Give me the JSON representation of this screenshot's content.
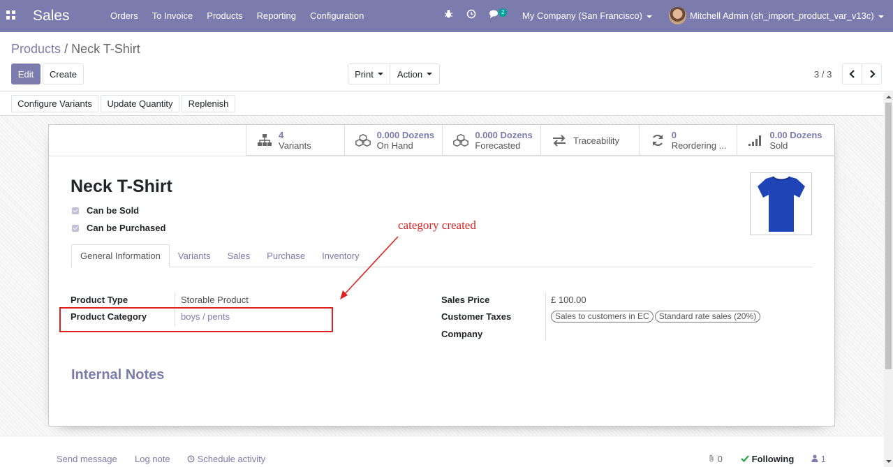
{
  "navbar": {
    "app_name": "Sales",
    "menu": [
      "Orders",
      "To Invoice",
      "Products",
      "Reporting",
      "Configuration"
    ],
    "chat_badge": "2",
    "company": "My Company (San Francisco)",
    "user": "Mitchell Admin (sh_import_product_var_v13c)"
  },
  "breadcrumb": {
    "parent": "Products",
    "separator": "/",
    "current": "Neck T-Shirt"
  },
  "toolbar": {
    "edit_label": "Edit",
    "create_label": "Create",
    "print_label": "Print",
    "action_label": "Action",
    "pager": "3 / 3"
  },
  "statusbar": {
    "configure_variants": "Configure Variants",
    "update_quantity": "Update Quantity",
    "replenish": "Replenish"
  },
  "stats": [
    {
      "value": "4",
      "label": "Variants",
      "icon": "sitemap-icon"
    },
    {
      "value": "0.000 Dozens",
      "label": "On Hand",
      "icon": "cubes-icon"
    },
    {
      "value": "0.000 Dozens",
      "label": "Forecasted",
      "icon": "cubes-icon"
    },
    {
      "value": "",
      "label": "Traceability",
      "icon": "exchange-icon"
    },
    {
      "value": "0",
      "label": "Reordering ...",
      "icon": "refresh-icon"
    },
    {
      "value": "0.00 Dozens",
      "label": "Sold",
      "icon": "signal-icon"
    }
  ],
  "product": {
    "name": "Neck T-Shirt",
    "can_be_sold": "Can be Sold",
    "can_be_purchased": "Can be Purchased",
    "image_color": "#1f44b8"
  },
  "tabs": [
    "General Information",
    "Variants",
    "Sales",
    "Purchase",
    "Inventory"
  ],
  "fields": {
    "product_type_label": "Product Type",
    "product_type_value": "Storable Product",
    "product_category_label": "Product Category",
    "product_category_value": "boys / pents",
    "sales_price_label": "Sales Price",
    "sales_price_value": "£ 100.00",
    "customer_taxes_label": "Customer Taxes",
    "customer_taxes_tags": [
      "Sales to customers in EC",
      "Standard rate sales (20%)"
    ],
    "company_label": "Company"
  },
  "internal_notes": "Internal Notes",
  "chatter": {
    "send_message": "Send message",
    "log_note": "Log note",
    "schedule_activity": "Schedule activity",
    "attachments": "0",
    "following": "Following",
    "followers": "1"
  },
  "annotation": {
    "text": "category created",
    "color": "#e02020"
  },
  "colors": {
    "brand": "#7c7bad"
  }
}
